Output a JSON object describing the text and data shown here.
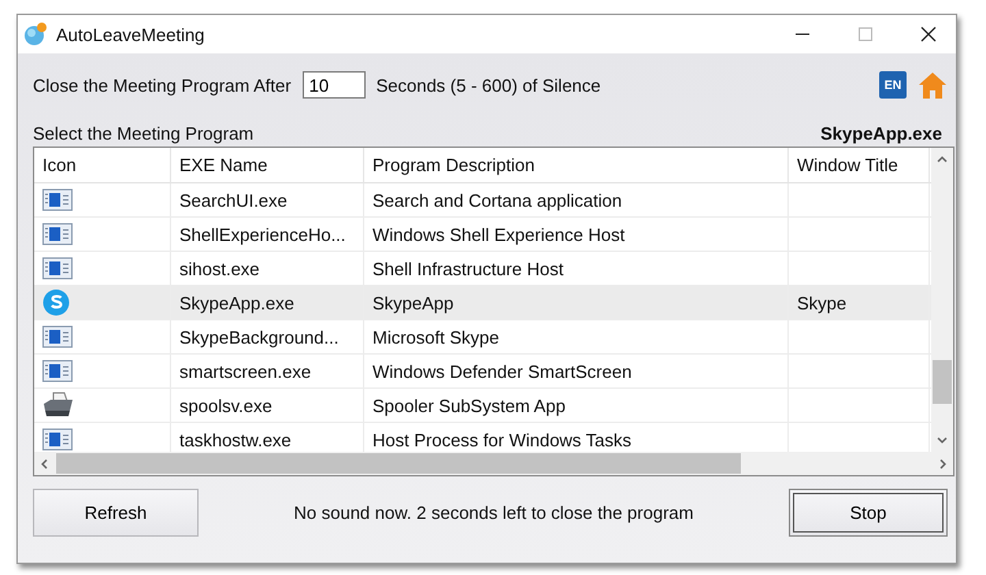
{
  "window": {
    "title": "AutoLeaveMeeting"
  },
  "timeout": {
    "label_before": "Close the Meeting Program After",
    "value": "10",
    "label_after": "Seconds (5 - 600) of Silence"
  },
  "language_button": {
    "label": "EN"
  },
  "section": {
    "label": "Select the Meeting Program",
    "selected_program": "SkypeApp.exe"
  },
  "table": {
    "columns": [
      "Icon",
      "EXE Name",
      "Program Description",
      "Window Title"
    ],
    "rows": [
      {
        "kind": "window",
        "exe": "SearchUI.exe",
        "description": "Search and Cortana application",
        "selected": false
      },
      {
        "kind": "window",
        "exe": "ShellExperienceHo...",
        "description": "Windows Shell Experience Host",
        "selected": false
      },
      {
        "kind": "window",
        "exe": "sihost.exe",
        "description": "Shell Infrastructure Host",
        "selected": false
      },
      {
        "kind": "skype",
        "exe": "SkypeApp.exe",
        "description": "SkypeApp",
        "window_title": "Skype",
        "selected": true
      },
      {
        "kind": "window",
        "exe": "SkypeBackground...",
        "description": "Microsoft Skype",
        "selected": false
      },
      {
        "kind": "window",
        "exe": "smartscreen.exe",
        "description": "Windows Defender SmartScreen",
        "selected": false
      },
      {
        "kind": "printer",
        "exe": "spoolsv.exe",
        "description": "Spooler SubSystem App",
        "selected": false
      },
      {
        "kind": "window",
        "exe": "taskhostw.exe",
        "description": "Host Process for Windows Tasks",
        "selected": false
      }
    ]
  },
  "buttons": {
    "refresh": "Refresh",
    "stop": "Stop"
  },
  "status": "No sound now. 2 seconds left to close the program"
}
